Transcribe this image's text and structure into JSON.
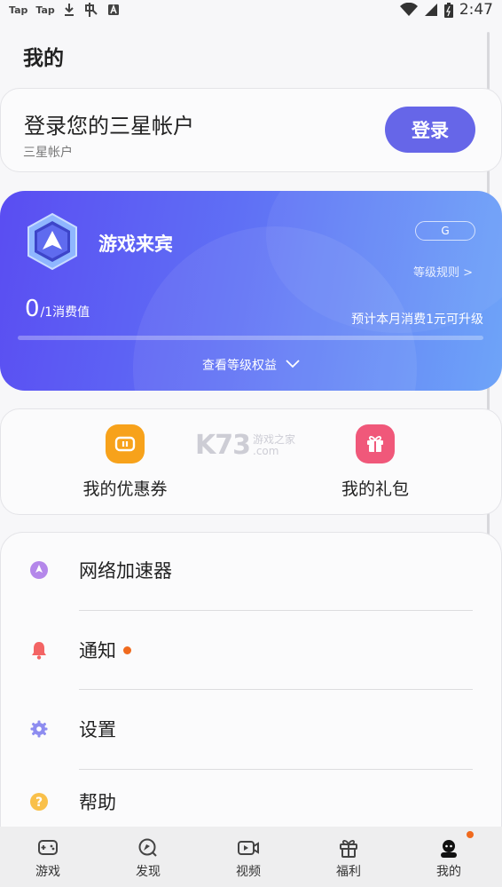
{
  "status_bar": {
    "app1": "Tap",
    "app2": "Tap",
    "time": "2:47",
    "icons": [
      "download-icon",
      "translate-icon",
      "keyboard-icon",
      "wifi-icon",
      "signal-icon",
      "battery-icon"
    ]
  },
  "page": {
    "title": "我的"
  },
  "account": {
    "title": "登录您的三星帐户",
    "subtitle": "三星帐户",
    "login_label": "登录"
  },
  "level": {
    "name": "游戏来宾",
    "grade": "G",
    "rules": "等级规则 >",
    "points_current": "0",
    "points_rest": "/1消费值",
    "upgrade_tip": "预计本月消费1元可升级",
    "progress": 0,
    "benefits": "查看等级权益"
  },
  "quick": {
    "coupons": "我的优惠券",
    "gifts": "我的礼包"
  },
  "watermark": {
    "logo": "K73",
    "line1": "游戏之家",
    "line2": ".com"
  },
  "menu": {
    "accelerator": "网络加速器",
    "notifications": "通知",
    "settings": "设置",
    "help": "帮助"
  },
  "nav": {
    "games": "游戏",
    "discover": "发现",
    "video": "视频",
    "welfare": "福利",
    "me": "我的"
  },
  "colors": {
    "accent": "#6666e8",
    "card_gradient_start": "#5a4df2",
    "card_gradient_end": "#6ea4f8",
    "badge_dot": "#f06a1e"
  }
}
